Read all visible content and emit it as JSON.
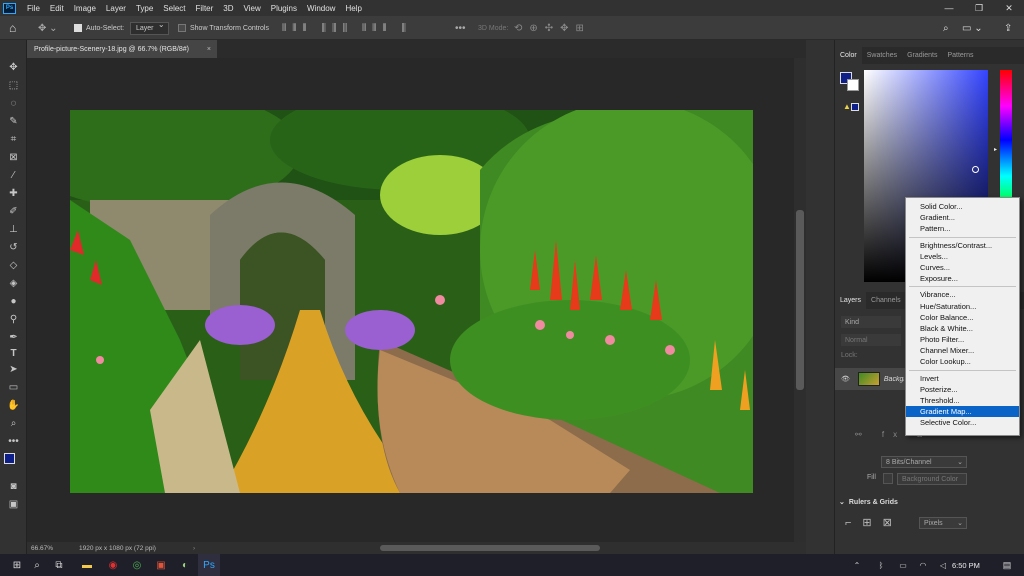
{
  "app": {
    "logo": "Ps"
  },
  "menu": [
    "File",
    "Edit",
    "Image",
    "Layer",
    "Type",
    "Select",
    "Filter",
    "3D",
    "View",
    "Plugins",
    "Window",
    "Help"
  ],
  "options": {
    "auto_select_label": "Auto-Select:",
    "auto_select_value": "Layer",
    "transform_controls_label": "Show Transform Controls",
    "mode_3d_label": "3D Mode:"
  },
  "document": {
    "tab_title": "Profile-picture-Scenery-18.jpg @ 66.7% (RGB/8#)",
    "close_glyph": "×",
    "zoom": "66.67%",
    "dimensions": "1920 px x 1080 px (72 ppi)"
  },
  "color_panel": {
    "tabs": [
      "Color",
      "Swatches",
      "Gradients",
      "Patterns"
    ],
    "fg": "#0e1f8a"
  },
  "layers_panel": {
    "tabs": [
      "Layers",
      "Channels"
    ],
    "kind": "Kind",
    "blend": "Normal",
    "lock": "Lock:",
    "layer_name": "Background"
  },
  "properties": {
    "bit_depth": "8 Bits/Channel",
    "fill_label": "Fill",
    "fill_value": "Background Color",
    "rulers_title": "Rulers & Grids",
    "units": "Pixels"
  },
  "adjust_menu": {
    "group1": [
      "Solid Color...",
      "Gradient...",
      "Pattern..."
    ],
    "group2": [
      "Brightness/Contrast...",
      "Levels...",
      "Curves...",
      "Exposure..."
    ],
    "group3": [
      "Vibrance...",
      "Hue/Saturation...",
      "Color Balance...",
      "Black & White...",
      "Photo Filter...",
      "Channel Mixer...",
      "Color Lookup..."
    ],
    "group4": [
      "Invert",
      "Posterize...",
      "Threshold...",
      "Gradient Map...",
      "Selective Color..."
    ],
    "highlighted": "Gradient Map..."
  },
  "taskbar": {
    "time": "6:50 PM"
  },
  "colors": {
    "accent": "#31a8ff",
    "highlight": "#0a64c8"
  }
}
